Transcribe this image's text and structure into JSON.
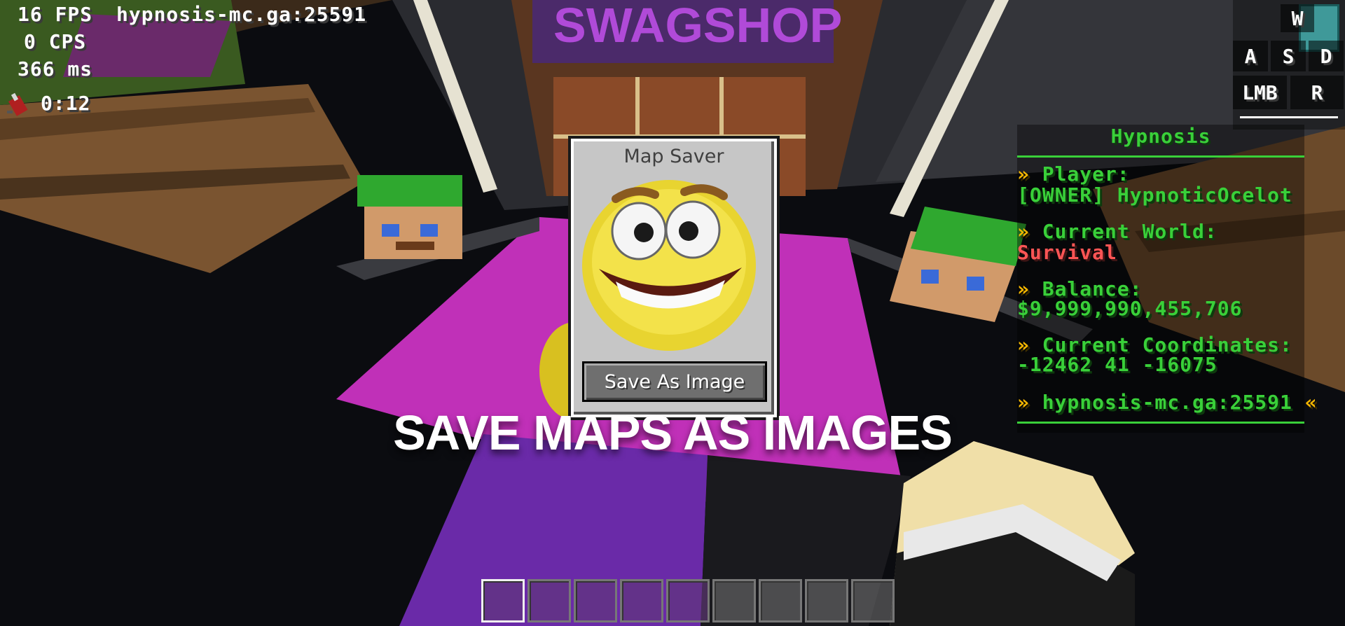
{
  "debug": {
    "fps": "16 FPS",
    "cps": "0 CPS",
    "ping": "366 ms",
    "server": "hypnosis-mc.ga:25591"
  },
  "effect": {
    "icon": "rocket-firework-icon",
    "timer": "0:12"
  },
  "keystrokes": {
    "w": "W",
    "a": "A",
    "s": "S",
    "d": "D",
    "lmb": "LMB",
    "rmb": "R"
  },
  "scoreboard": {
    "title": "Hypnosis",
    "player_label": "Player:",
    "player_value": "[OWNER] HypnoticOcelot",
    "world_label": "Current World:",
    "world_value": "Survival",
    "balance_label": "Balance:",
    "balance_value": "$9,999,990,455,706",
    "coords_label": "Current Coordinates:",
    "coords_value": "-12462 41 -16075",
    "footer": "hypnosis-mc.ga:25591",
    "arrow": "»",
    "arrow_close": "«",
    "colors": {
      "title": "#39d039",
      "value": "#39d039",
      "world": "#ff5555",
      "arrow": "#f6b700"
    }
  },
  "map_gui": {
    "title": "Map Saver",
    "button_label": "Save As Image",
    "image_icon": "smiley-face-icon"
  },
  "caption": "SAVE MAPS AS IMAGES",
  "hotbar": {
    "slots": 9,
    "selected_index": 0
  }
}
